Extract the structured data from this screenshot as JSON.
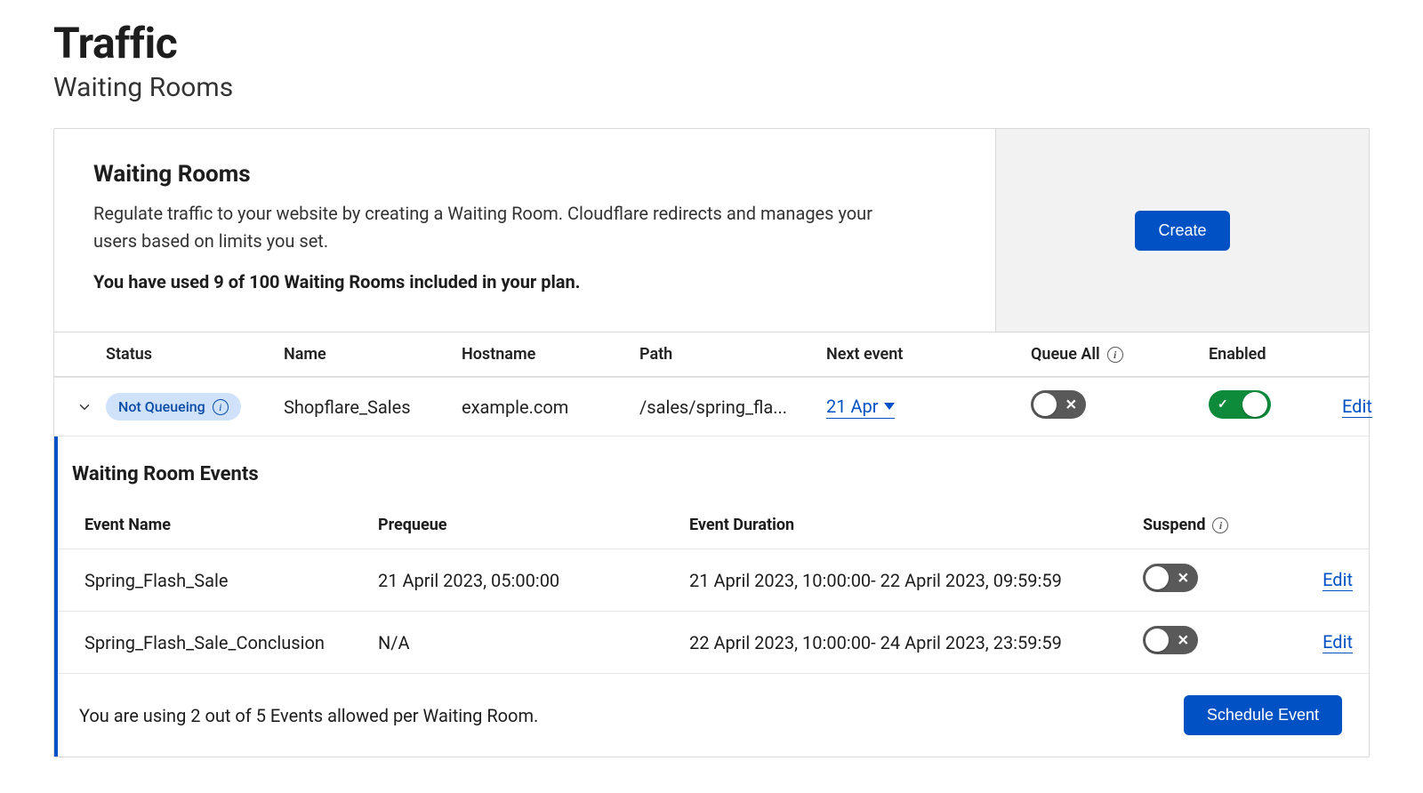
{
  "header": {
    "title": "Traffic",
    "subtitle": "Waiting Rooms"
  },
  "intro": {
    "heading": "Waiting Rooms",
    "description": "Regulate traffic to your website by creating a Waiting Room. Cloudflare redirects and manages your users based on limits you set.",
    "usage": "You have used 9 of 100 Waiting Rooms included in your plan.",
    "create_label": "Create"
  },
  "rooms_table": {
    "columns": {
      "status": "Status",
      "name": "Name",
      "hostname": "Hostname",
      "path": "Path",
      "next_event": "Next event",
      "queue_all": "Queue All",
      "enabled": "Enabled"
    },
    "row": {
      "status": "Not Queueing",
      "name": "Shopflare_Sales",
      "hostname": "example.com",
      "path": "/sales/spring_fla...",
      "next_event": "21 Apr",
      "queue_all_on": false,
      "enabled_on": true,
      "edit_label": "Edit"
    }
  },
  "events": {
    "heading": "Waiting Room Events",
    "columns": {
      "event_name": "Event Name",
      "prequeue": "Prequeue",
      "duration": "Event Duration",
      "suspend": "Suspend"
    },
    "rows": [
      {
        "name": "Spring_Flash_Sale",
        "prequeue": "21 April 2023, 05:00:00",
        "duration": "21 April 2023, 10:00:00- 22 April 2023, 09:59:59",
        "suspend_on": false,
        "edit_label": "Edit"
      },
      {
        "name": "Spring_Flash_Sale_Conclusion",
        "prequeue": "N/A",
        "duration": "22 April 2023, 10:00:00- 24 April 2023, 23:59:59",
        "suspend_on": false,
        "edit_label": "Edit"
      }
    ],
    "footer_text": "You are using 2 out of 5 Events allowed per Waiting Room.",
    "schedule_label": "Schedule Event"
  }
}
